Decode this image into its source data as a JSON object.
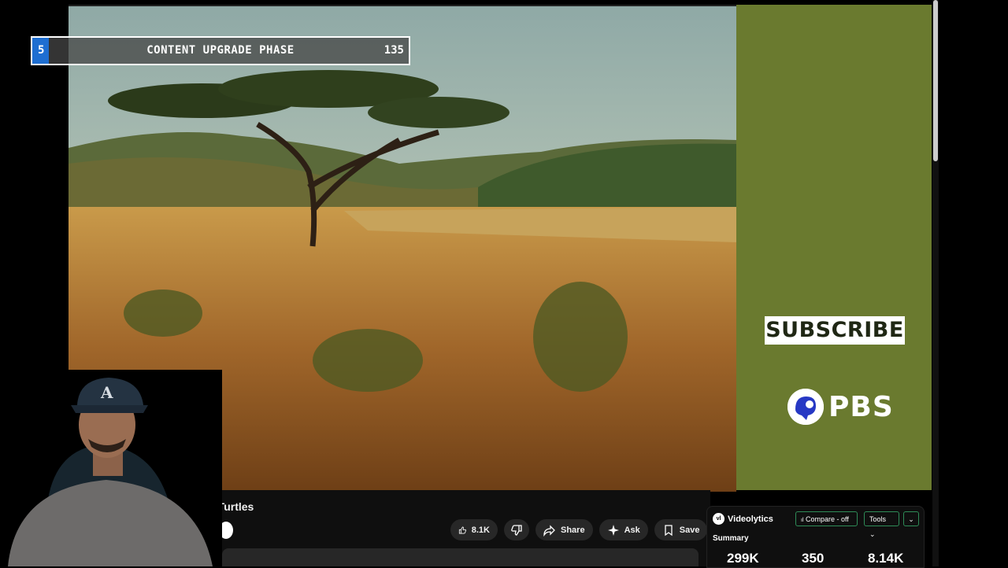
{
  "overlay": {
    "left_number": "5",
    "phase_label": "CONTENT UPGRADE PHASE",
    "right_number": "135"
  },
  "side_panel": {
    "subscribe_label": "SUBSCRIBE",
    "brand": "PBS",
    "bg_color": "#6a7a2f"
  },
  "video": {
    "title_fragment": "a Turtles"
  },
  "actions": {
    "like_count": "8.1K",
    "share_label": "Share",
    "ask_label": "Ask",
    "save_label": "Save"
  },
  "videolytics": {
    "brand": "Videolytics",
    "compare_label": "Compare - off",
    "tools_label": "Tools",
    "summary_label": "Summary",
    "stats": [
      "299K",
      "350",
      "8.14K"
    ],
    "accent_color": "#2e8b57"
  },
  "icons": [
    "thumbs-up-icon",
    "thumbs-down-icon",
    "share-icon",
    "sparkle-icon",
    "bookmark-icon",
    "more-icon",
    "chevron-down-icon",
    "bar-chart-icon"
  ]
}
